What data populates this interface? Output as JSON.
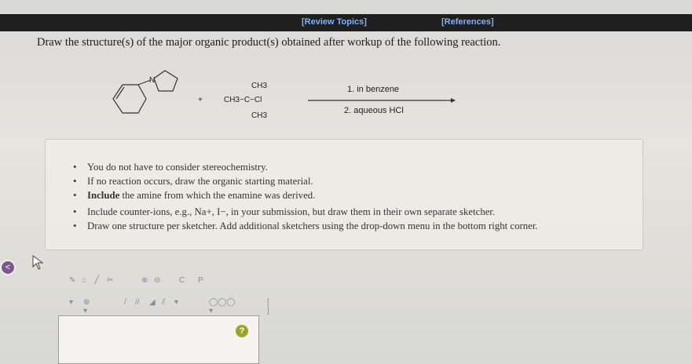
{
  "links": {
    "review": "[Review Topics]",
    "references": "[References]"
  },
  "question": "Draw the structure(s) of the major organic product(s) obtained after workup of the following reaction.",
  "reaction": {
    "plus": "+",
    "reagent_top": "CH3",
    "reagent_mid": "CH3−C−Cl",
    "reagent_bottom": "CH3",
    "step1": "1. in benzene",
    "step2": "2. aqueous HCl",
    "amine_atom": "N"
  },
  "notes": [
    "You do not have to consider stereochemistry.",
    "If no reaction occurs, draw the organic starting material.",
    "Include",
    "the amine from which the enamine was derived.",
    "Include counter-ions, e.g., Na+, I−, in your submission, but draw them in their own separate sketcher.",
    "Draw one structure per sketcher. Add additional sketchers using the drop-down menu in the bottom right corner."
  ],
  "sketcher": {
    "help": "?",
    "toolbar_c": "C",
    "toolbar_p": "P"
  },
  "nav": {
    "back": "<"
  }
}
